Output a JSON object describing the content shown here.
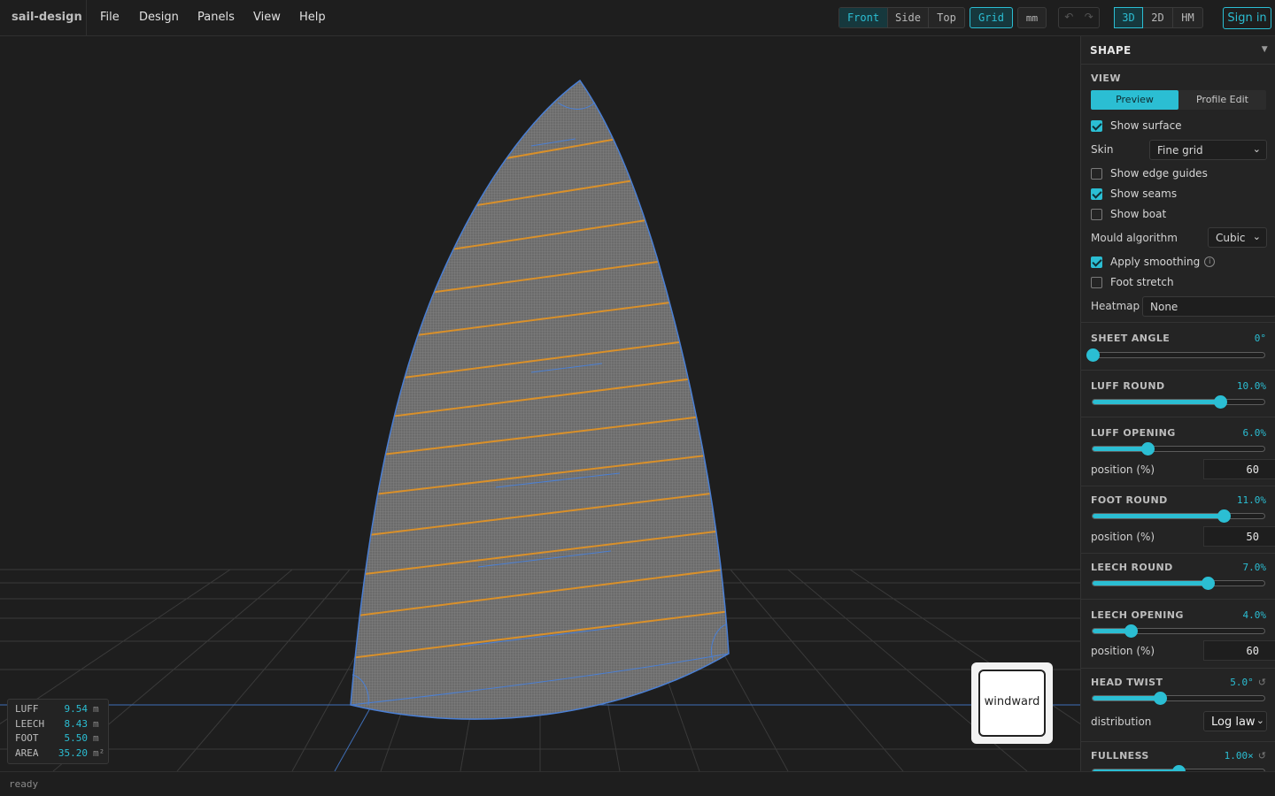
{
  "app": {
    "title": "sail-design"
  },
  "menu": [
    "File",
    "Design",
    "Panels",
    "View",
    "Help"
  ],
  "toolbar": {
    "views": [
      "Front",
      "Side",
      "Top"
    ],
    "active_view": "Front",
    "grid_label": "Grid",
    "units_label": "mm",
    "undo_icon": "↶",
    "redo_icon": "↷",
    "modes": [
      "3D",
      "2D",
      "HM"
    ],
    "active_mode": "3D",
    "signin_label": "Sign in"
  },
  "measurements": [
    {
      "key": "LUFF",
      "value": "9.54",
      "unit": "m"
    },
    {
      "key": "LEECH",
      "value": "8.43",
      "unit": "m"
    },
    {
      "key": "FOOT",
      "value": "5.50",
      "unit": "m"
    },
    {
      "key": "AREA",
      "value": "35.20",
      "unit": "m²"
    }
  ],
  "orientation_cube": {
    "label": "windward"
  },
  "status": {
    "text": "ready"
  },
  "colors": {
    "accent": "#2bbed3",
    "background": "#1e1e1e",
    "sail_edge": "#4a7fd4",
    "seam_orange": "#d9902a"
  },
  "panel": {
    "title": "SHAPE",
    "view_section": {
      "title": "VIEW",
      "tabs": [
        "Preview",
        "Profile Edit"
      ],
      "active_tab": "Preview",
      "show_surface": {
        "label": "Show surface",
        "checked": true
      },
      "skin": {
        "label": "Skin",
        "value": "Fine grid"
      },
      "show_edge_guides": {
        "label": "Show edge guides",
        "checked": false
      },
      "show_seams": {
        "label": "Show seams",
        "checked": true
      },
      "show_boat": {
        "label": "Show boat",
        "checked": false
      },
      "mould": {
        "label": "Mould algorithm",
        "value": "Cubic"
      },
      "apply_smoothing": {
        "label": "Apply smoothing",
        "checked": true,
        "info": "i"
      },
      "foot_stretch": {
        "label": "Foot stretch",
        "checked": false
      },
      "heatmap": {
        "label": "Heatmap",
        "value": "None"
      }
    },
    "sheet_angle": {
      "title": "SHEET ANGLE",
      "value": "0°",
      "fraction": 0.0
    },
    "luff_round": {
      "title": "LUFF ROUND",
      "value": "10.0%",
      "fraction": 0.74
    },
    "luff_opening": {
      "title": "LUFF OPENING",
      "value": "6.0%",
      "fraction": 0.32,
      "position_label": "position (%)",
      "position": "60"
    },
    "foot_round": {
      "title": "FOOT ROUND",
      "value": "11.0%",
      "fraction": 0.765,
      "position_label": "position (%)",
      "position": "50"
    },
    "leech_round": {
      "title": "LEECH ROUND",
      "value": "7.0%",
      "fraction": 0.67
    },
    "leech_opening": {
      "title": "LEECH OPENING",
      "value": "4.0%",
      "fraction": 0.22,
      "position_label": "position (%)",
      "position": "60"
    },
    "head_twist": {
      "title": "HEAD TWIST",
      "value": "5.0°",
      "fraction": 0.39,
      "distribution_label": "distribution",
      "distribution": "Log law",
      "reset_icon": "↺"
    },
    "fullness": {
      "title": "FULLNESS",
      "value": "1.00×",
      "fraction": 0.5,
      "reset_icon": "↺"
    }
  }
}
